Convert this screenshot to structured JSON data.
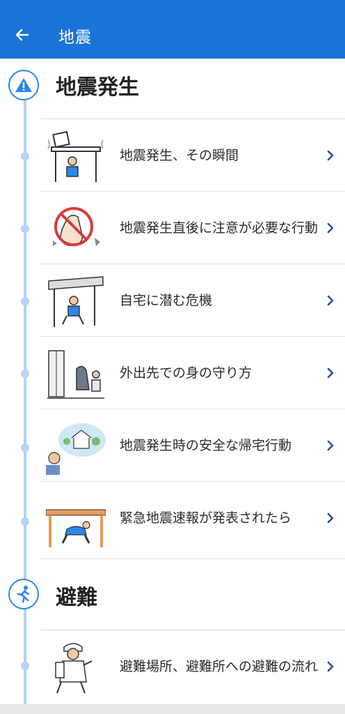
{
  "header": {
    "title": "地震"
  },
  "sections": [
    {
      "title": "地震発生",
      "items": [
        {
          "label": "地震発生、その瞬間"
        },
        {
          "label": "地震発生直後に注意が必要な行動"
        },
        {
          "label": "自宅に潜む危機"
        },
        {
          "label": "外出先での身の守り方"
        },
        {
          "label": "地震発生時の安全な帰宅行動"
        },
        {
          "label": "緊急地震速報が発表されたら"
        }
      ]
    },
    {
      "title": "避難",
      "items": [
        {
          "label": "避難場所、避難所への避難の流れ"
        }
      ]
    }
  ],
  "colors": {
    "appbar": "#1a73d9",
    "accent": "#2a86e8",
    "timeline": "#b6d4f5",
    "chevron": "#1f4e8c"
  }
}
